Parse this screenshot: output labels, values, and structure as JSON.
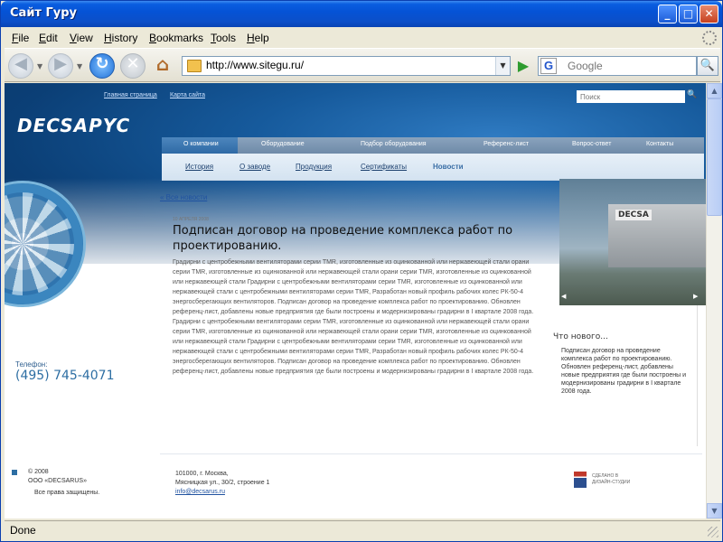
{
  "window": {
    "title": "Сайт Гуру"
  },
  "menu": [
    "File",
    "Edit",
    "View",
    "History",
    "Bookmarks",
    "Tools",
    "Help"
  ],
  "toolbar": {
    "url": "http://www.sitegu.ru/",
    "search_placeholder": "Google"
  },
  "status": "Done",
  "site": {
    "top_links": [
      "Главная страница",
      "Карта сайта"
    ],
    "search_placeholder": "Поиск",
    "logo": "DECSAPYC",
    "main_nav": [
      "О компании",
      "Оборудование",
      "Подбор оборудования",
      "Референс-лист",
      "Вопрос-ответ",
      "Контакты"
    ],
    "sub_nav": [
      "История",
      "О заводе",
      "Продукция",
      "Сертификаты",
      "Новости"
    ],
    "phone_label": "Телефон:",
    "phone": "(495) 745-4071",
    "back_link": "« Все новости",
    "news_date": "10 АПРЕЛЯ 2008",
    "news_title": "Подписан договор на проведение комплекса работ по проектированию.",
    "news_body": "Градирни с центробежными вентиляторами серии TMR, изготовленные из оцинкованной или нержавеющей стали орани серии TMR, изготовленные из оцинкованной или нержавеющей стали орани серии TMR, изготовленные из оцинкованной или нержавеющей стали Градирни с центробежными вентиляторами серии TMR, изготовленные из оцинкованной или нержавеющей стали с центробежными вентиляторами серии TMR, Разработан новый профиль рабочих колес РК-50-4 энергосберегающих вентиляторов. Подписан договор на проведение комплекса работ по проектированию. Обновлен референц-лист, добавлены новые предприятия где были построены и модернизированы градирни в I квартале 2008 года. Градирни с центробежными вентиляторами серии TMR, изготовленные из оцинкованной или нержавеющей стали орани серии TMR, изготовленные из оцинкованной или нержавеющей стали орани серии TMR, изготовленные из оцинкованной или нержавеющей стали Градирни с центробежными вентиляторами серии TMR, изготовленные из оцинкованной или нержавеющей стали с центробежными вентиляторами серии TMR, Разработан новый профиль рабочих колес РК-50-4 энергосберегающих вентиляторов. Подписан договор на проведение комплекса работ по проектированию. Обновлен референц-лист, добавлены новые предприятия где были построены и модернизированы градирни в I квартале 2008 года.",
    "photo_sign": "DECSA",
    "whats_new_title": "Что нового...",
    "whats_new_text": "Подписан договор на проведение комплекса работ по проектированию. Обновлен референц-лист, добавлены новые предприятия где были построены и модернизированы градирни в I квартале 2008 года.",
    "copyright_lines": [
      "© 2008",
      "ООО «DECSARUS»"
    ],
    "rights": "Все права защищены.",
    "address_lines": [
      "101000, г. Москва,",
      "Мясницкая ул., 30/2, строение 1"
    ],
    "email": "info@decsarus.ru",
    "maker_lines": [
      "СДЕЛАНО В",
      "ДИЗАЙН-СТУДИИ"
    ]
  }
}
